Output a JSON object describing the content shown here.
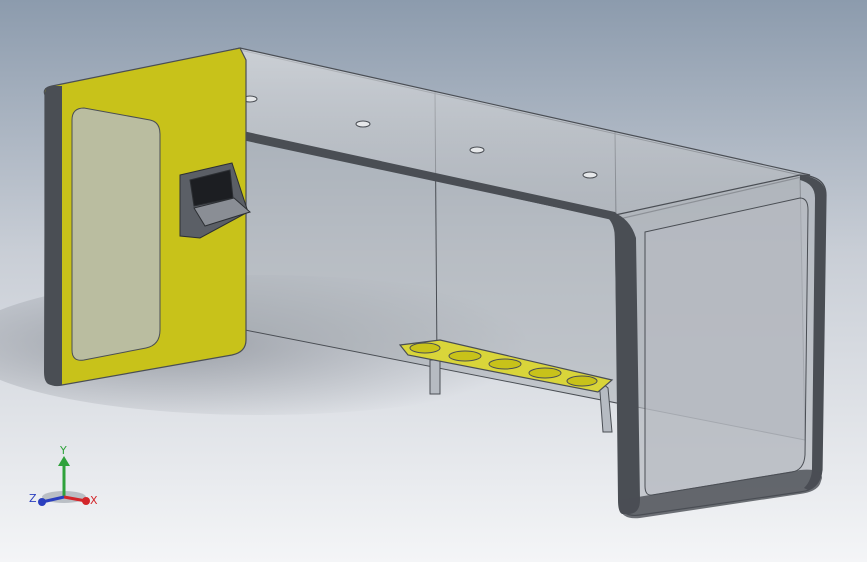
{
  "viewport": {
    "background_top": "#8c9bad",
    "background_mid": "#c9ced6",
    "background_bottom": "#f4f5f7"
  },
  "model": {
    "glass_color": "#b8bcc2",
    "frame_color": "#4a4e54",
    "yellow_panel_color": "#c8c21a",
    "seat_color": "#d9d53a",
    "kiosk_color": "#5b5f66",
    "screen_color": "#1c1e22"
  },
  "triad": {
    "x_label": "X",
    "y_label": "Y",
    "z_label": "Z",
    "x_color": "#d3262b",
    "y_color": "#2fa23b",
    "z_color": "#2b3fbf"
  }
}
